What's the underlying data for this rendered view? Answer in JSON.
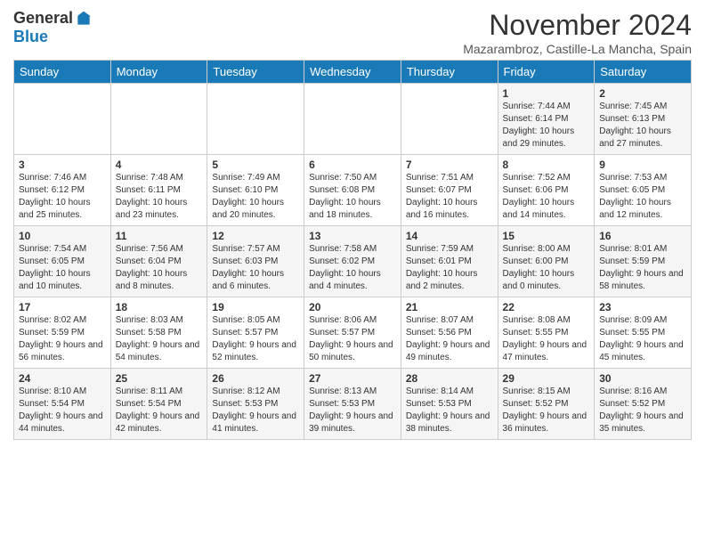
{
  "header": {
    "logo_general": "General",
    "logo_blue": "Blue",
    "month_title": "November 2024",
    "location": "Mazarambroz, Castille-La Mancha, Spain"
  },
  "days_of_week": [
    "Sunday",
    "Monday",
    "Tuesday",
    "Wednesday",
    "Thursday",
    "Friday",
    "Saturday"
  ],
  "weeks": [
    [
      {
        "day": "",
        "info": ""
      },
      {
        "day": "",
        "info": ""
      },
      {
        "day": "",
        "info": ""
      },
      {
        "day": "",
        "info": ""
      },
      {
        "day": "",
        "info": ""
      },
      {
        "day": "1",
        "info": "Sunrise: 7:44 AM\nSunset: 6:14 PM\nDaylight: 10 hours and 29 minutes."
      },
      {
        "day": "2",
        "info": "Sunrise: 7:45 AM\nSunset: 6:13 PM\nDaylight: 10 hours and 27 minutes."
      }
    ],
    [
      {
        "day": "3",
        "info": "Sunrise: 7:46 AM\nSunset: 6:12 PM\nDaylight: 10 hours and 25 minutes."
      },
      {
        "day": "4",
        "info": "Sunrise: 7:48 AM\nSunset: 6:11 PM\nDaylight: 10 hours and 23 minutes."
      },
      {
        "day": "5",
        "info": "Sunrise: 7:49 AM\nSunset: 6:10 PM\nDaylight: 10 hours and 20 minutes."
      },
      {
        "day": "6",
        "info": "Sunrise: 7:50 AM\nSunset: 6:08 PM\nDaylight: 10 hours and 18 minutes."
      },
      {
        "day": "7",
        "info": "Sunrise: 7:51 AM\nSunset: 6:07 PM\nDaylight: 10 hours and 16 minutes."
      },
      {
        "day": "8",
        "info": "Sunrise: 7:52 AM\nSunset: 6:06 PM\nDaylight: 10 hours and 14 minutes."
      },
      {
        "day": "9",
        "info": "Sunrise: 7:53 AM\nSunset: 6:05 PM\nDaylight: 10 hours and 12 minutes."
      }
    ],
    [
      {
        "day": "10",
        "info": "Sunrise: 7:54 AM\nSunset: 6:05 PM\nDaylight: 10 hours and 10 minutes."
      },
      {
        "day": "11",
        "info": "Sunrise: 7:56 AM\nSunset: 6:04 PM\nDaylight: 10 hours and 8 minutes."
      },
      {
        "day": "12",
        "info": "Sunrise: 7:57 AM\nSunset: 6:03 PM\nDaylight: 10 hours and 6 minutes."
      },
      {
        "day": "13",
        "info": "Sunrise: 7:58 AM\nSunset: 6:02 PM\nDaylight: 10 hours and 4 minutes."
      },
      {
        "day": "14",
        "info": "Sunrise: 7:59 AM\nSunset: 6:01 PM\nDaylight: 10 hours and 2 minutes."
      },
      {
        "day": "15",
        "info": "Sunrise: 8:00 AM\nSunset: 6:00 PM\nDaylight: 10 hours and 0 minutes."
      },
      {
        "day": "16",
        "info": "Sunrise: 8:01 AM\nSunset: 5:59 PM\nDaylight: 9 hours and 58 minutes."
      }
    ],
    [
      {
        "day": "17",
        "info": "Sunrise: 8:02 AM\nSunset: 5:59 PM\nDaylight: 9 hours and 56 minutes."
      },
      {
        "day": "18",
        "info": "Sunrise: 8:03 AM\nSunset: 5:58 PM\nDaylight: 9 hours and 54 minutes."
      },
      {
        "day": "19",
        "info": "Sunrise: 8:05 AM\nSunset: 5:57 PM\nDaylight: 9 hours and 52 minutes."
      },
      {
        "day": "20",
        "info": "Sunrise: 8:06 AM\nSunset: 5:57 PM\nDaylight: 9 hours and 50 minutes."
      },
      {
        "day": "21",
        "info": "Sunrise: 8:07 AM\nSunset: 5:56 PM\nDaylight: 9 hours and 49 minutes."
      },
      {
        "day": "22",
        "info": "Sunrise: 8:08 AM\nSunset: 5:55 PM\nDaylight: 9 hours and 47 minutes."
      },
      {
        "day": "23",
        "info": "Sunrise: 8:09 AM\nSunset: 5:55 PM\nDaylight: 9 hours and 45 minutes."
      }
    ],
    [
      {
        "day": "24",
        "info": "Sunrise: 8:10 AM\nSunset: 5:54 PM\nDaylight: 9 hours and 44 minutes."
      },
      {
        "day": "25",
        "info": "Sunrise: 8:11 AM\nSunset: 5:54 PM\nDaylight: 9 hours and 42 minutes."
      },
      {
        "day": "26",
        "info": "Sunrise: 8:12 AM\nSunset: 5:53 PM\nDaylight: 9 hours and 41 minutes."
      },
      {
        "day": "27",
        "info": "Sunrise: 8:13 AM\nSunset: 5:53 PM\nDaylight: 9 hours and 39 minutes."
      },
      {
        "day": "28",
        "info": "Sunrise: 8:14 AM\nSunset: 5:53 PM\nDaylight: 9 hours and 38 minutes."
      },
      {
        "day": "29",
        "info": "Sunrise: 8:15 AM\nSunset: 5:52 PM\nDaylight: 9 hours and 36 minutes."
      },
      {
        "day": "30",
        "info": "Sunrise: 8:16 AM\nSunset: 5:52 PM\nDaylight: 9 hours and 35 minutes."
      }
    ]
  ]
}
